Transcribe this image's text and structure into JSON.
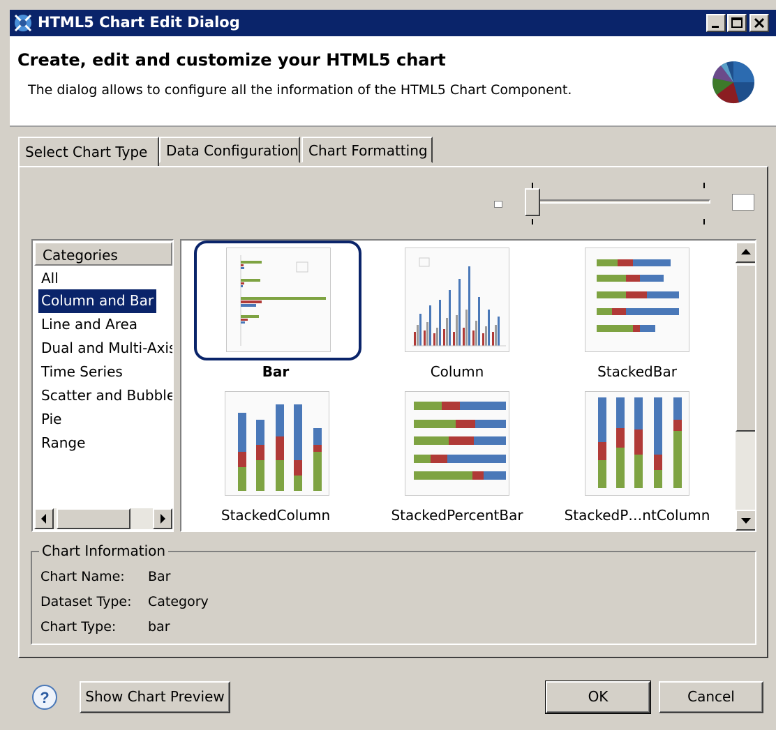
{
  "window": {
    "title": "HTML5 Chart Edit Dialog"
  },
  "banner": {
    "heading": "Create, edit and customize your HTML5 chart",
    "description": "The dialog allows to configure all the information of the HTML5 Chart Component."
  },
  "tabs": [
    {
      "label": "Select Chart Type",
      "active": true
    },
    {
      "label": "Data Configuration",
      "active": false
    },
    {
      "label": "Chart Formatting",
      "active": false
    }
  ],
  "categories": {
    "header": "Categories",
    "items": [
      "All",
      "Column and Bar",
      "Line and Area",
      "Dual and Multi-Axis",
      "Time Series",
      "Scatter and Bubble",
      "Pie",
      "Range"
    ],
    "selected": "Column and Bar"
  },
  "gallery": {
    "items": [
      {
        "label": "Bar",
        "selected": true
      },
      {
        "label": "Column",
        "selected": false
      },
      {
        "label": "StackedBar",
        "selected": false
      },
      {
        "label": "StackedColumn",
        "selected": false
      },
      {
        "label": "StackedPercentBar",
        "selected": false
      },
      {
        "label": "StackedP…ntColumn",
        "selected": false
      }
    ]
  },
  "chart_info": {
    "legend": "Chart Information",
    "rows": [
      {
        "label": "Chart Name:",
        "value": "Bar"
      },
      {
        "label": "Dataset Type:",
        "value": "Category"
      },
      {
        "label": "Chart Type:",
        "value": "bar"
      }
    ]
  },
  "buttons": {
    "preview": "Show Chart Preview",
    "ok": "OK",
    "cancel": "Cancel"
  },
  "colors": {
    "title_bar": "#0a246a",
    "selection": "#0a246a",
    "green": "#7ea342",
    "red": "#b03a37",
    "blue": "#4a78b8"
  },
  "icons": [
    "chart-app-icon",
    "minimize-icon",
    "maximize-icon",
    "close-icon",
    "pie-chart-icon",
    "help-icon",
    "scroll-left-icon",
    "scroll-right-icon",
    "scroll-up-icon",
    "scroll-down-icon"
  ]
}
